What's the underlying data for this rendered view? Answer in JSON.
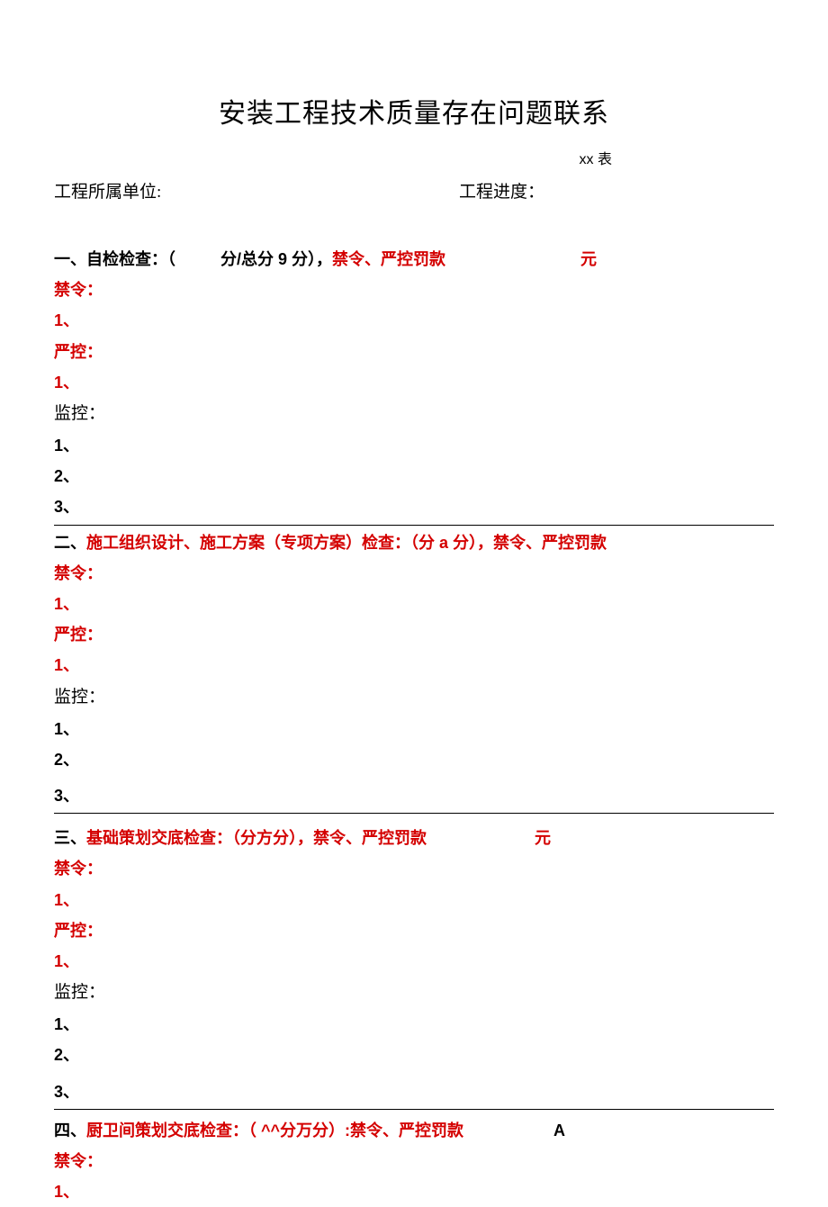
{
  "title": "安装工程技术质量存在问题联系",
  "table_label": "xx 表",
  "header": {
    "left": "工程所属单位:",
    "right": "工程进度："
  },
  "sections": [
    {
      "prefix": "一、",
      "heading_black": "自检检查：（",
      "heading_black2": "分/总分 9 分），",
      "penalty": "禁令、严控罚款",
      "unit": "元",
      "ban_label": "禁令：",
      "ban_items": [
        "1、"
      ],
      "strict_label": "严控：",
      "strict_items": [
        "1、"
      ],
      "mon_label": "监控：",
      "mon_items": [
        "1、",
        "2、",
        "3、"
      ]
    },
    {
      "prefix": "二、",
      "heading_red": "施工组织设计、施工方案（专项方案）检查：（分 a 分），",
      "penalty": "禁令、严控罚款",
      "unit": "",
      "ban_label": "禁令：",
      "ban_items": [
        "1、"
      ],
      "strict_label": "严控：",
      "strict_items": [
        "1、"
      ],
      "mon_label": "监控：",
      "mon_items": [
        "1、",
        "2、",
        "3、"
      ]
    },
    {
      "prefix": "三、",
      "heading_red": "基础策划交底检查：（分方分），",
      "penalty": "禁令、严控罚款",
      "unit": "元",
      "ban_label": "禁令：",
      "ban_items": [
        "1、"
      ],
      "strict_label": "严控：",
      "strict_items": [
        "1、"
      ],
      "mon_label": "监控：",
      "mon_items": [
        "1、",
        "2、",
        "3、"
      ]
    },
    {
      "prefix": "四、",
      "heading_red": "厨卫间策划交底检查：（ ^^分万分）:",
      "penalty": "禁令、严控罚款",
      "unit": "A",
      "ban_label": "禁令：",
      "ban_items": [
        "1、"
      ]
    }
  ]
}
